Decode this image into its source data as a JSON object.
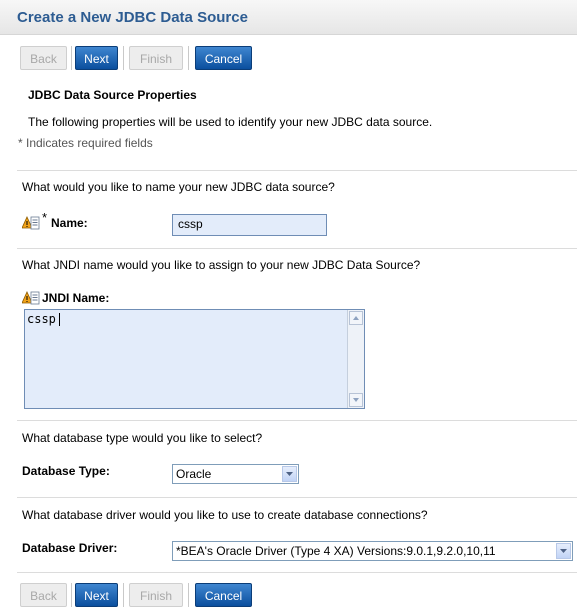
{
  "header": {
    "title": "Create a New JDBC Data Source"
  },
  "buttons": {
    "back": "Back",
    "next": "Next",
    "finish": "Finish",
    "cancel": "Cancel"
  },
  "section": {
    "heading": "JDBC Data Source Properties",
    "description": "The following properties will be used to identify your new JDBC data source.",
    "required_note": "* Indicates required fields"
  },
  "name_field": {
    "question": "What would you like to name your new JDBC data source?",
    "required_mark": "*",
    "label": "Name:",
    "value": "cssp"
  },
  "jndi_field": {
    "question": "What JNDI name would you like to assign to your new JDBC Data Source?",
    "label": "JNDI Name:",
    "value": "cssp"
  },
  "db_type": {
    "question": "What database type would you like to select?",
    "label": "Database Type:",
    "value": "Oracle"
  },
  "db_driver": {
    "question": "What database driver would you like to use to create database connections?",
    "label": "Database Driver:",
    "value": "*BEA's Oracle Driver (Type 4 XA) Versions:9.0.1,9.2.0,10,11"
  },
  "colors": {
    "title": "#2d5c92",
    "button_active": "#0b4f9e",
    "input_bg": "#e3ecfa",
    "warning_icon": "#f2a31a"
  },
  "icons": {
    "info_warning": "warning-info-icon"
  }
}
